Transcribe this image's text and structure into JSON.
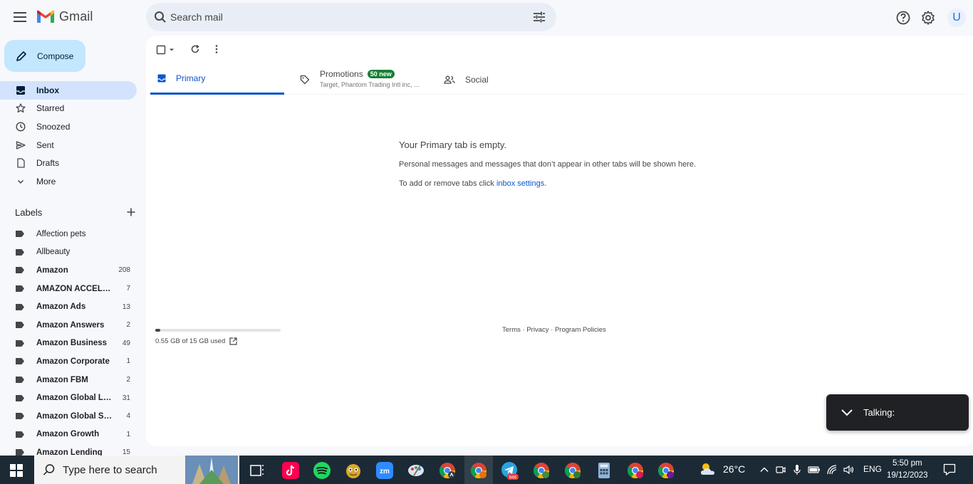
{
  "app": {
    "name": "Gmail"
  },
  "search": {
    "placeholder": "Search mail"
  },
  "header": {
    "avatar_letter": "U"
  },
  "sidebar": {
    "compose_label": "Compose",
    "items": [
      {
        "label": "Inbox",
        "icon": "inbox-icon"
      },
      {
        "label": "Starred",
        "icon": "star-icon"
      },
      {
        "label": "Snoozed",
        "icon": "clock-icon"
      },
      {
        "label": "Sent",
        "icon": "send-icon"
      },
      {
        "label": "Drafts",
        "icon": "draft-icon"
      },
      {
        "label": "More",
        "icon": "chevron-down-icon"
      }
    ],
    "labels_title": "Labels",
    "labels": [
      {
        "name": "Affection pets",
        "count": ""
      },
      {
        "name": "Allbeauty",
        "count": ""
      },
      {
        "name": "Amazon",
        "count": "208"
      },
      {
        "name": "AMAZON ACCELERATOR",
        "count": "7"
      },
      {
        "name": "Amazon Ads",
        "count": "13"
      },
      {
        "name": "Amazon Answers",
        "count": "2"
      },
      {
        "name": "Amazon Business",
        "count": "49"
      },
      {
        "name": "Amazon Corporate",
        "count": "1"
      },
      {
        "name": "Amazon FBM",
        "count": "2"
      },
      {
        "name": "Amazon Global Logistics",
        "count": "31"
      },
      {
        "name": "Amazon Global Selling",
        "count": "4"
      },
      {
        "name": "Amazon Growth",
        "count": "1"
      },
      {
        "name": "Amazon Lending",
        "count": "15"
      }
    ]
  },
  "tabs": {
    "primary": "Primary",
    "promotions": "Promotions",
    "promotions_badge": "50 new",
    "promotions_snippet": "Target, Phantom Trading Intl inc, ...",
    "social": "Social"
  },
  "empty_state": {
    "title": "Your Primary tab is empty.",
    "text": "Personal messages and messages that don’t appear in other tabs will be shown here.",
    "settings_prefix": "To add or remove tabs click ",
    "settings_link": "inbox settings",
    "settings_suffix": "."
  },
  "storage": {
    "used_text": "0.55 GB of 15 GB used",
    "fraction_used": 0.037
  },
  "footer": {
    "terms": "Terms",
    "privacy": "Privacy",
    "policies": "Program Policies",
    "sep": " · "
  },
  "toast": {
    "label": "Talking:"
  },
  "taskbar": {
    "search_placeholder": "Type here to search",
    "telegram_badge": "846",
    "temperature": "26°C",
    "language": "ENG",
    "time": "5:50 pm",
    "date": "19/12/2023"
  },
  "colors": {
    "accent": "#0b57d0",
    "compose_bg": "#c2e7ff",
    "active_nav_bg": "#d3e3fd",
    "badge_green": "#188038",
    "taskbar_bg": "#1c2a36"
  }
}
